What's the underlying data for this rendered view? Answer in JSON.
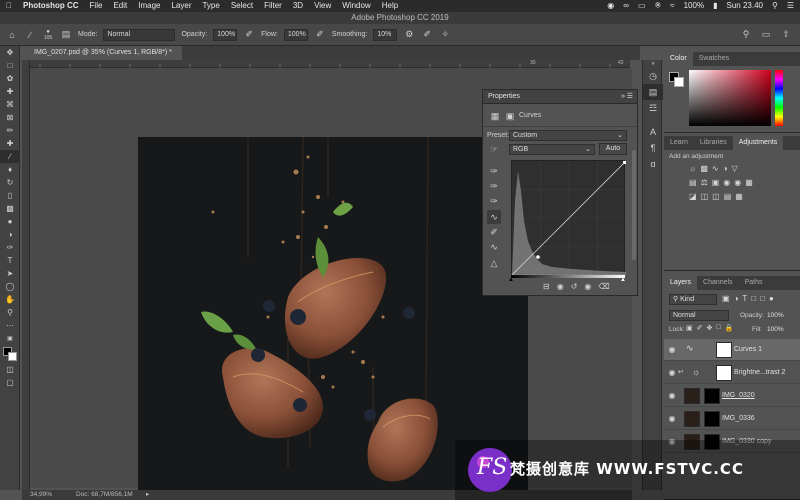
{
  "macbar": {
    "app_name": "Photoshop CC",
    "menus": [
      "File",
      "Edit",
      "Image",
      "Layer",
      "Type",
      "Select",
      "Filter",
      "3D",
      "View",
      "Window",
      "Help"
    ],
    "battery": "100%",
    "clock": "Sun 23.40"
  },
  "window_title": "Adobe Photoshop CC 2019",
  "options_bar": {
    "brush_size": "105",
    "mode_label": "Mode:",
    "mode_value": "Normal",
    "opacity_label": "Opacity:",
    "opacity_value": "100%",
    "flow_label": "Flow:",
    "flow_value": "100%",
    "smoothing_label": "Smoothing:",
    "smoothing_value": "10%"
  },
  "document_tab": "IMG_0207.psd @ 35% (Curves 1, RGB/8*) *",
  "rulers": {
    "top_label_42": "42",
    "top_label_30": "30"
  },
  "status_bar": {
    "zoom": "34,99%",
    "doc_size": "Doc: 68,7M/856,1M"
  },
  "properties": {
    "title": "Properties",
    "layer_type": "Curves",
    "preset_label": "Preset:",
    "preset_value": "Custom",
    "channel_value": "RGB",
    "auto_button": "Auto"
  },
  "color_panel": {
    "tabs": [
      "Color",
      "Swatches"
    ]
  },
  "adjustments_panel": {
    "tabs": [
      "Learn",
      "Libraries",
      "Adjustments"
    ],
    "add_label": "Add an adjustment"
  },
  "layers_panel": {
    "tabs": [
      "Layers",
      "Channels",
      "Paths"
    ],
    "filter_kind": "Kind",
    "blend_mode": "Normal",
    "opacity_label": "Opacity:",
    "opacity_value": "100%",
    "lock_label": "Lock:",
    "fill_label": "Fill:",
    "fill_value": "100%",
    "layers": [
      {
        "name": "Curves 1",
        "selected": true
      },
      {
        "name": "Brightne...trast 2",
        "selected": false
      },
      {
        "name": "IMG_0320",
        "selected": false
      },
      {
        "name": "IMG_0336",
        "selected": false
      },
      {
        "name": "IMG_0330 copy",
        "selected": false
      }
    ]
  },
  "watermark": {
    "logo_letters": "FS",
    "text": "梵摄创意库  WWW.FSTVC.CC"
  },
  "colors": {
    "app_bg": "#535353",
    "panel_dark": "#424242",
    "accent_red": "#d0001c"
  }
}
